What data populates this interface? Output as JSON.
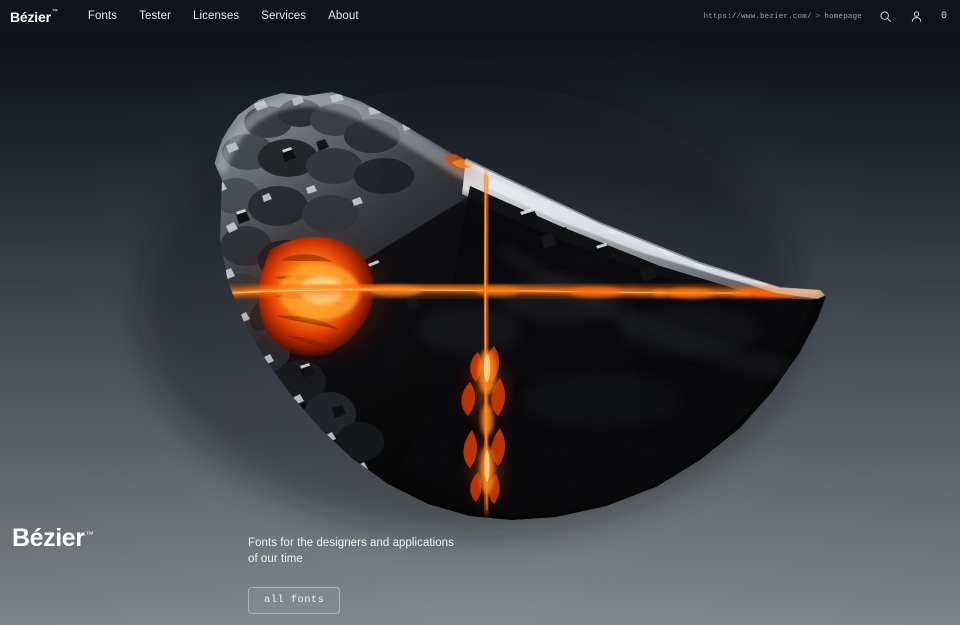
{
  "header": {
    "brand": {
      "name": "Bézier",
      "tm": "™"
    },
    "nav_items": [
      {
        "label": "Fonts"
      },
      {
        "label": "Tester"
      },
      {
        "label": "Licenses"
      },
      {
        "label": "Services"
      },
      {
        "label": "About"
      }
    ],
    "breadcrumb": {
      "url": "https://www.bezier.com/",
      "separator": ">",
      "page": "homepage"
    },
    "icons": {
      "search": "search-icon",
      "account": "account-icon"
    },
    "cart_count": "0"
  },
  "hero": {
    "wordmark": "Bézier",
    "wordmark_tm": "™",
    "tagline_line1": "Fonts for the designers and applications",
    "tagline_line2": "of our time",
    "cta_label": "all fonts"
  },
  "artwork": {
    "name": "glowing-volcanic-rock",
    "description": "Dark volcanic meteorite fragment with molten orange cracks",
    "colors": {
      "rock_dark": "#0a0a0c",
      "rock_gray": "#5d6268",
      "rock_highlight": "#c9ced3",
      "lava_core": "#ffd27a",
      "lava_mid": "#ff7a10",
      "lava_deep": "#c01d02"
    }
  },
  "theme": {
    "bg_top": "#0b0d14",
    "bg_bottom": "#7b8287",
    "header_bg": "#10121c",
    "text_primary": "#ffffff",
    "text_muted": "#9fa3ad"
  }
}
